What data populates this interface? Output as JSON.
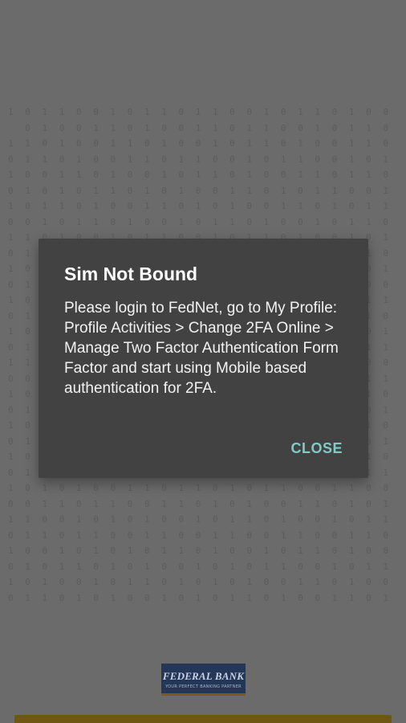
{
  "dialog": {
    "title": "Sim Not Bound",
    "message": "Please login to FedNet, go to My Profile: Profile Activities > Change 2FA Online > Manage Two Factor Authentication Form Factor and start using Mobile based authentication for 2FA.",
    "close_label": "CLOSE"
  },
  "logo": {
    "title": "FEDERAL BANK",
    "tagline": "YOUR PERFECT BANKING PARTNER"
  },
  "colors": {
    "dialog_background": "#424242",
    "accent": "#80cbc4",
    "scrim": "#6b6b6b",
    "logo_background": "#243759"
  }
}
